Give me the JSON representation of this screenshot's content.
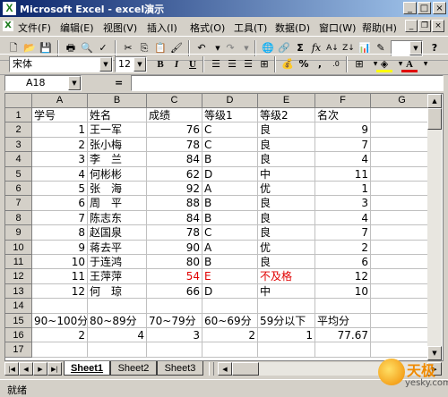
{
  "window": {
    "title": "Microsoft Excel - excel演示",
    "icon_letter": "X"
  },
  "window_buttons": {
    "minimize": "_",
    "maximize": "□",
    "close": "×"
  },
  "menu": [
    "文件(F)",
    "编辑(E)",
    "视图(V)",
    "插入(I)",
    "格式(O)",
    "工具(T)",
    "数据(D)",
    "窗口(W)",
    "帮助(H)"
  ],
  "format": {
    "font": "宋体",
    "size": "12"
  },
  "name_box": "A18",
  "formula_sign": "=",
  "columns": [
    "A",
    "B",
    "C",
    "D",
    "E",
    "F",
    "G"
  ],
  "rows": [
    {
      "n": "1",
      "A": "学号",
      "B": "姓名",
      "C": "成绩",
      "D": "等级1",
      "E": "等级2",
      "F": "名次"
    },
    {
      "n": "2",
      "A": "1",
      "B": "王一军",
      "C": "76",
      "D": "C",
      "E": "良",
      "F": "9"
    },
    {
      "n": "3",
      "A": "2",
      "B": "张小梅",
      "C": "78",
      "D": "C",
      "E": "良",
      "F": "7"
    },
    {
      "n": "4",
      "A": "3",
      "B": "李　兰",
      "C": "84",
      "D": "B",
      "E": "良",
      "F": "4"
    },
    {
      "n": "5",
      "A": "4",
      "B": "何彬彬",
      "C": "62",
      "D": "D",
      "E": "中",
      "F": "11"
    },
    {
      "n": "6",
      "A": "5",
      "B": "张　海",
      "C": "92",
      "D": "A",
      "E": "优",
      "F": "1"
    },
    {
      "n": "7",
      "A": "6",
      "B": "周　平",
      "C": "88",
      "D": "B",
      "E": "良",
      "F": "3"
    },
    {
      "n": "8",
      "A": "7",
      "B": "陈志东",
      "C": "84",
      "D": "B",
      "E": "良",
      "F": "4"
    },
    {
      "n": "9",
      "A": "8",
      "B": "赵国泉",
      "C": "78",
      "D": "C",
      "E": "良",
      "F": "7"
    },
    {
      "n": "10",
      "A": "9",
      "B": "蒋去平",
      "C": "90",
      "D": "A",
      "E": "优",
      "F": "2"
    },
    {
      "n": "11",
      "A": "10",
      "B": "于连鸿",
      "C": "80",
      "D": "B",
      "E": "良",
      "F": "6"
    },
    {
      "n": "12",
      "A": "11",
      "B": "王萍萍",
      "C": "54",
      "D": "E",
      "E": "不及格",
      "F": "12",
      "red": true
    },
    {
      "n": "13",
      "A": "12",
      "B": "何　琼",
      "C": "66",
      "D": "D",
      "E": "中",
      "F": "10"
    },
    {
      "n": "14",
      "A": "",
      "B": "",
      "C": "",
      "D": "",
      "E": "",
      "F": ""
    },
    {
      "n": "15",
      "A": "90~100分",
      "B": "80~89分",
      "C": "70~79分",
      "D": "60~69分",
      "E": "59分以下",
      "F": "平均分"
    },
    {
      "n": "16",
      "A": "2",
      "B": "4",
      "C": "3",
      "D": "2",
      "E": "1",
      "F": "77.67"
    },
    {
      "n": "17",
      "A": "",
      "B": "",
      "C": "",
      "D": "",
      "E": "",
      "F": ""
    }
  ],
  "sheets": [
    "Sheet1",
    "Sheet2",
    "Sheet3"
  ],
  "active_sheet": "Sheet1",
  "status": "就绪",
  "watermark": {
    "name": "天极",
    "site": "yesky.com"
  },
  "colors": {
    "title_start": "#0a246a",
    "title_end": "#a6caf0",
    "red_text": "#e00000"
  }
}
